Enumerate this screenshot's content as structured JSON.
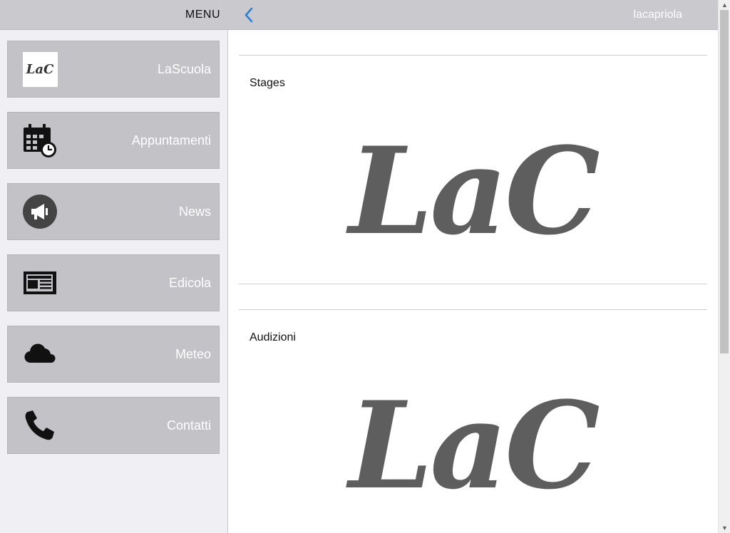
{
  "sidebar": {
    "header": "MENU",
    "items": [
      {
        "label": "LaScuola",
        "icon": "lac-logo-icon",
        "logo_text": "LaC"
      },
      {
        "label": "Appuntamenti",
        "icon": "calendar-clock-icon"
      },
      {
        "label": "News",
        "icon": "megaphone-icon"
      },
      {
        "label": "Edicola",
        "icon": "newspaper-icon"
      },
      {
        "label": "Meteo",
        "icon": "cloud-icon"
      },
      {
        "label": "Contatti",
        "icon": "phone-icon"
      }
    ]
  },
  "topbar": {
    "title": "lacapriola",
    "back_icon": "chevron-left-icon",
    "accent_color": "#2a7fd4"
  },
  "sections": [
    {
      "title": "Stages",
      "logo_text": "LaC"
    },
    {
      "title": "Audizioni",
      "logo_text": "LaC"
    }
  ],
  "scrollbar": {
    "up": "▲",
    "down": "▼"
  }
}
